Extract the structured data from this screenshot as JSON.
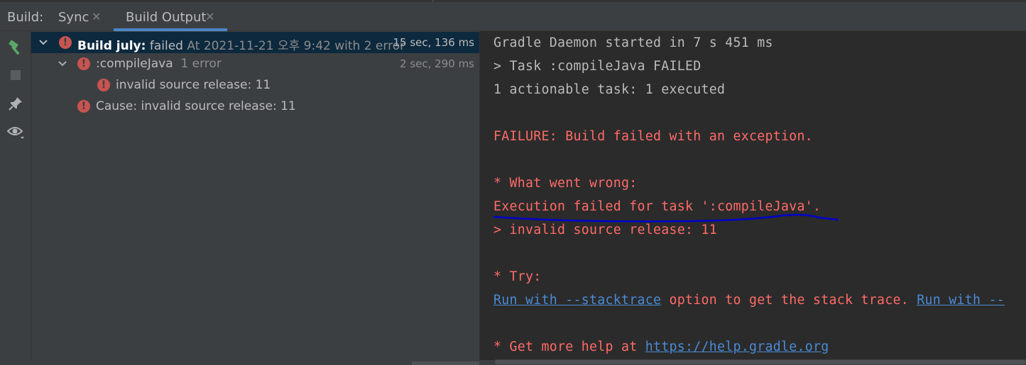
{
  "header": {
    "build_label": "Build:",
    "tabs": [
      {
        "label": "Sync",
        "close": "✕"
      },
      {
        "label": "Build Output",
        "close": "✕"
      }
    ]
  },
  "toolbar": {
    "icons": [
      "hammer-icon",
      "stop-icon",
      "pin-icon",
      "eye-icon"
    ]
  },
  "tree": {
    "rows": [
      {
        "name_bold": "Build july:",
        "status": " failed",
        "detail": " At 2021-11-21 오후 9:42 with 2 error",
        "time": "15 sec, 136 ms"
      },
      {
        "name": ":compileJava",
        "detail": "1 error",
        "time": "2 sec, 290 ms"
      },
      {
        "text": "invalid source release: 11"
      },
      {
        "text": "Cause: invalid source release: 11"
      }
    ]
  },
  "console": {
    "lines": [
      "Gradle Daemon started in 7 s 451 ms",
      "> Task :compileJava FAILED",
      "1 actionable task: 1 executed",
      "FAILURE: Build failed with an exception.",
      "* What went wrong:",
      "Execution failed for task ':compileJava'.",
      "> invalid source release: 11",
      "* Try:",
      "* Get more help at "
    ],
    "try_link1": "Run with --stacktrace",
    "try_mid": " option to get the stack trace. ",
    "try_link2": "Run with --",
    "help_link": "https://help.gradle.org"
  },
  "colors": {
    "error_red": "#ff6b68",
    "link_blue": "#4a8bd6",
    "annotation_underline": "#0000cc",
    "selection": "#0d293e"
  }
}
